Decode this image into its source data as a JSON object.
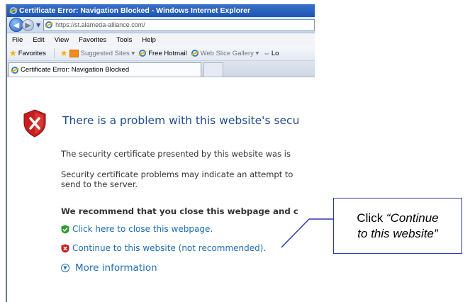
{
  "window": {
    "title": "Certificate Error: Navigation Blocked - Windows Internet Explorer"
  },
  "address": {
    "url": "https://st.alameda-alliance.com/"
  },
  "menu": {
    "items": [
      "File",
      "Edit",
      "View",
      "Favorites",
      "Tools",
      "Help"
    ]
  },
  "favorites": {
    "label": "Favorites",
    "suggested": "Suggested Sites ▾",
    "hotmail": "Free Hotmail",
    "slice": "Web Slice Gallery ▾",
    "more": "Lo"
  },
  "tab": {
    "title": "Certificate Error: Navigation Blocked"
  },
  "page": {
    "heading": "There is a problem with this website's secu",
    "para1": "The security certificate presented by this website was is",
    "para2_line1": "Security certificate problems may indicate an attempt to",
    "para2_line2": "send to the server.",
    "recommend": "We recommend that you close this webpage and c",
    "close_link": "Click here to close this webpage.",
    "continue_link": "Continue to this website (not recommended).",
    "more_info": "More information"
  },
  "callout": {
    "line1_plain": "Click ",
    "line1_em": "“Continue",
    "line2_em": "to this website”"
  },
  "colors": {
    "link": "#1e6db6",
    "heading": "#1f4d8f",
    "callout_border": "#2a39a8"
  }
}
